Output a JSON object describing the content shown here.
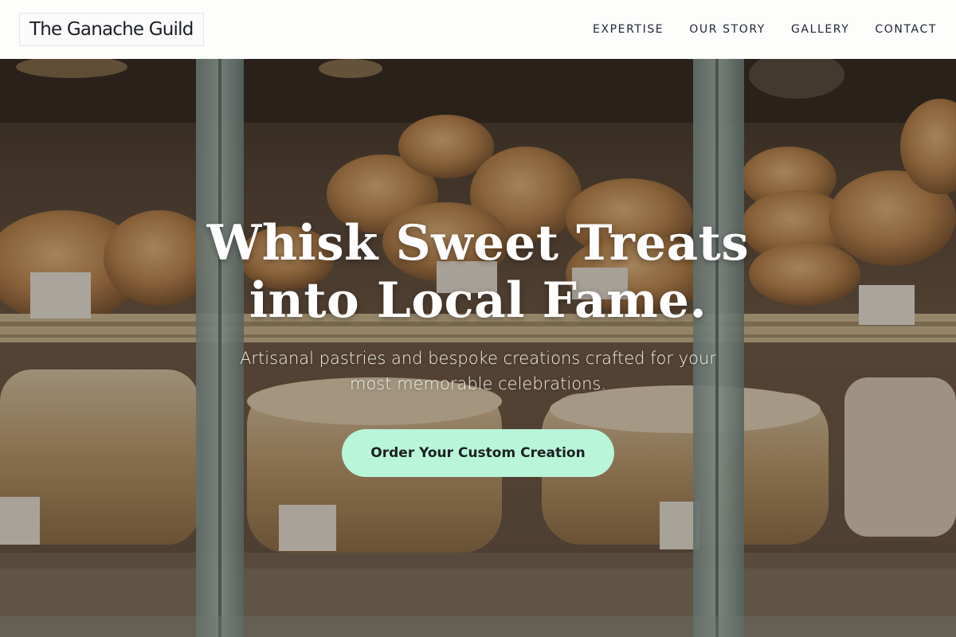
{
  "header": {
    "logo": "The Ganache Guild",
    "nav": [
      {
        "label": "EXPERTISE"
      },
      {
        "label": "OUR STORY"
      },
      {
        "label": "GALLERY"
      },
      {
        "label": "CONTACT"
      }
    ]
  },
  "hero": {
    "title_line1": "Whisk Sweet Treats",
    "title_line2": "into Local Fame.",
    "subtitle": "Artisanal pastries and bespoke creations crafted for your most memorable celebrations.",
    "cta_label": "Order Your Custom Creation",
    "background_image": "bakery-display-photo"
  },
  "colors": {
    "header_bg": "#fdfefc",
    "cta_bg": "#b8f5d9",
    "text_dark": "#1b1e26",
    "hero_text": "#ffffff"
  }
}
